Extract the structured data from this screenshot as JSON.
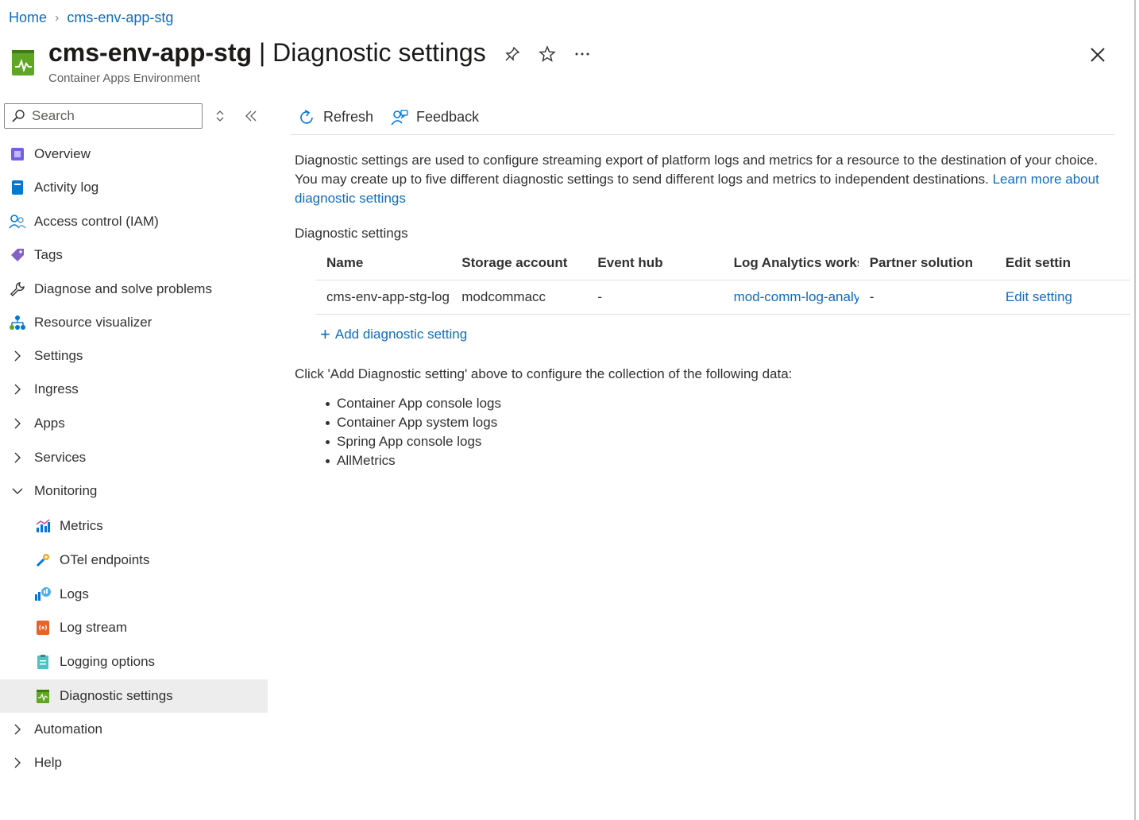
{
  "breadcrumb": {
    "home": "Home",
    "resource": "cms-env-app-stg"
  },
  "header": {
    "resource_name": "cms-env-app-stg",
    "separator": " | ",
    "page_name": "Diagnostic settings",
    "subtitle": "Container Apps Environment"
  },
  "sidebar": {
    "search_placeholder": "Search",
    "items": [
      {
        "label": "Overview"
      },
      {
        "label": "Activity log"
      },
      {
        "label": "Access control (IAM)"
      },
      {
        "label": "Tags"
      },
      {
        "label": "Diagnose and solve problems"
      },
      {
        "label": "Resource visualizer"
      },
      {
        "label": "Settings"
      },
      {
        "label": "Ingress"
      },
      {
        "label": "Apps"
      },
      {
        "label": "Services"
      },
      {
        "label": "Monitoring"
      },
      {
        "label": "Metrics"
      },
      {
        "label": "OTel endpoints"
      },
      {
        "label": "Logs"
      },
      {
        "label": "Log stream"
      },
      {
        "label": "Logging options"
      },
      {
        "label": "Diagnostic settings"
      },
      {
        "label": "Automation"
      },
      {
        "label": "Help"
      }
    ]
  },
  "toolbar": {
    "refresh": "Refresh",
    "feedback": "Feedback"
  },
  "main": {
    "description": "Diagnostic settings are used to configure streaming export of platform logs and metrics for a resource to the destination of your choice. You may create up to five different diagnostic settings to send different logs and metrics to independent destinations.",
    "learn_more": "Learn more about diagnostic settings",
    "section_label": "Diagnostic settings",
    "table": {
      "headers": [
        "Name",
        "Storage account",
        "Event hub",
        "Log Analytics works...",
        "Partner solution",
        "Edit settin"
      ],
      "rows": [
        [
          "cms-env-app-stg-log",
          "modcommacc",
          "-",
          "mod-comm-log-analyt",
          "-",
          "Edit setting"
        ]
      ]
    },
    "add_setting": "Add diagnostic setting",
    "collect_note": "Click 'Add Diagnostic setting' above to configure the collection of the following data:",
    "collect_items": [
      "Container App console logs",
      "Container App system logs",
      "Spring App console logs",
      "AllMetrics"
    ]
  },
  "colors": {
    "link": "#0f6cbd",
    "active_bg": "#ededed",
    "text": "#323130"
  }
}
